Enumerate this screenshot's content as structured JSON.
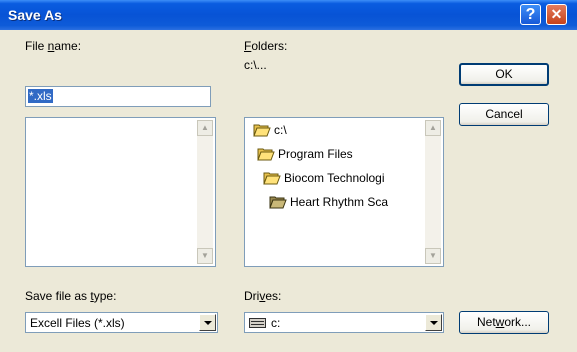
{
  "dialog": {
    "title": "Save As",
    "help_label": "?",
    "close_label": "✕"
  },
  "file_name": {
    "label_pre": "File ",
    "label_key": "n",
    "label_post": "ame:",
    "value": "*.xls"
  },
  "folders": {
    "label_pre": "",
    "label_key": "F",
    "label_post": "olders:",
    "current_path": "c:\\...",
    "items": [
      {
        "name": "c:\\",
        "state": "open"
      },
      {
        "name": "Program Files",
        "state": "open"
      },
      {
        "name": "Biocom Technologi",
        "state": "open"
      },
      {
        "name": "Heart Rhythm Sca",
        "state": "open-selected"
      }
    ]
  },
  "buttons": {
    "ok": "OK",
    "cancel": "Cancel",
    "network_pre": "Net",
    "network_key": "w",
    "network_post": "ork..."
  },
  "save_type": {
    "label_pre": "Save file as ",
    "label_key": "t",
    "label_post": "ype:",
    "value": "Excell Files (*.xls)"
  },
  "drives": {
    "label_pre": "Dri",
    "label_key": "v",
    "label_post": "es:",
    "value": "c:"
  },
  "colors": {
    "titlebar": "#0753D6",
    "selection": "#316AC5",
    "dialog_bg": "#ECE9D8",
    "folder_yellow": "#FFE27A"
  }
}
